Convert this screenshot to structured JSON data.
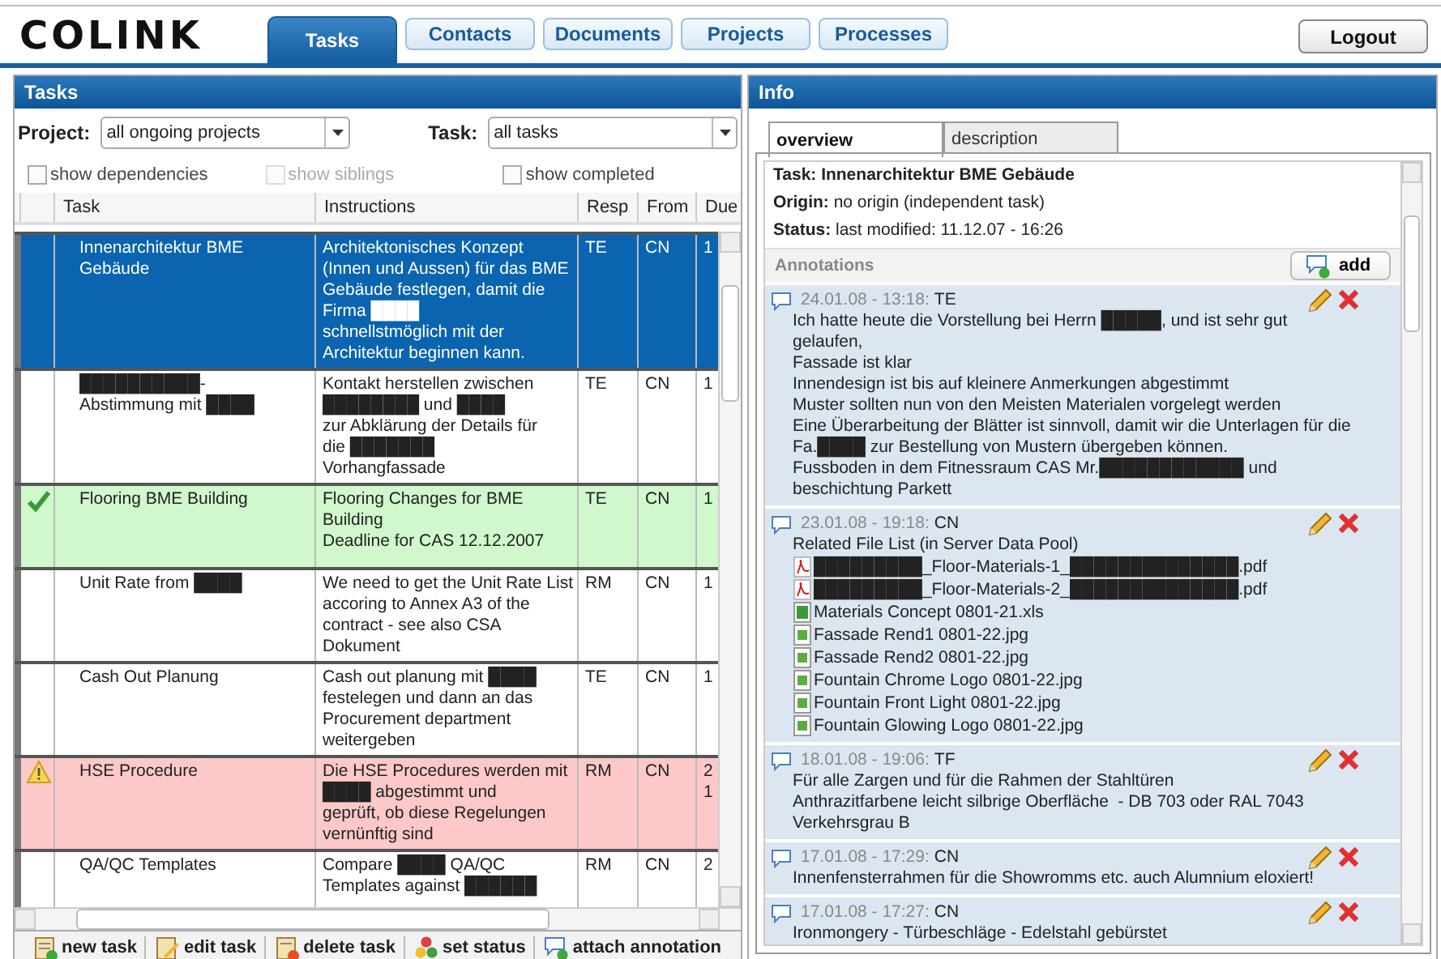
{
  "header": {
    "logo": "COLINK",
    "tabs": [
      {
        "label": "Tasks",
        "selected": true
      },
      {
        "label": "Contacts",
        "selected": false
      },
      {
        "label": "Documents",
        "selected": false
      },
      {
        "label": "Projects",
        "selected": false
      },
      {
        "label": "Processes",
        "selected": false
      }
    ],
    "logout": "Logout"
  },
  "tasks_panel": {
    "title": "Tasks",
    "filters": [
      {
        "label": "Project:",
        "value": "all ongoing projects"
      },
      {
        "label": "Task:",
        "value": "all tasks"
      }
    ],
    "options": [
      {
        "label": "show dependencies",
        "checked": false,
        "disabled": false
      },
      {
        "label": "show siblings",
        "checked": false,
        "disabled": true
      },
      {
        "label": "show completed",
        "checked": false,
        "disabled": false
      }
    ],
    "table": {
      "columns": [
        "Task",
        "Instructions",
        "Resp",
        "From",
        "Due"
      ],
      "rows": [
        {
          "selected": true,
          "kind": "plain",
          "task": "Innenarchitektur BME Gebäude",
          "instructions": "Architektonisches Konzept (Innen und Aussen) für das BME Gebäude festlegen, damit die Firma ████\nschnellstmöglich mit der Architektur beginnen kann.",
          "resp": "TE",
          "from": "CN",
          "due": "1"
        },
        {
          "selected": false,
          "kind": "plain",
          "task": "██████████-\nAbstimmung mit ████",
          "instructions": "Kontakt herstellen zwischen\n████████ und ████\nzur Abklärung der Details für\ndie ███████\nVorhangfassade",
          "resp": "TE",
          "from": "CN",
          "due": "1"
        },
        {
          "selected": false,
          "kind": "done",
          "task": "Flooring BME Building",
          "instructions": "Flooring Changes for BME Building\nDeadline for CAS 12.12.2007",
          "resp": "TE",
          "from": "CN",
          "due": "1"
        },
        {
          "selected": false,
          "kind": "plain",
          "task": "Unit Rate from ████",
          "instructions": "We need to get the Unit Rate List accoring to Annex A3 of the contract - see also CSA Dokument",
          "resp": "RM",
          "from": "CN",
          "due": "1"
        },
        {
          "selected": false,
          "kind": "plain",
          "task": "Cash Out Planung",
          "instructions": "Cash out planung mit ████\nfestelegen und dann an das Procurement department weitergeben",
          "resp": "TE",
          "from": "CN",
          "due": "1"
        },
        {
          "selected": false,
          "kind": "warning",
          "task": "HSE Procedure",
          "instructions": "Die HSE Procedures werden mit ████ abgestimmt und\ngeprüft, ob diese Regelungen vernünftig sind",
          "resp": "RM",
          "from": "CN",
          "due": "21"
        },
        {
          "selected": false,
          "kind": "plain",
          "task": "QA/QC Templates",
          "instructions": "Compare ████ QA/QC\nTemplates against ██████",
          "resp": "RM",
          "from": "CN",
          "due": "2"
        }
      ]
    },
    "toolbar": [
      {
        "kind": "new",
        "label": "new task"
      },
      {
        "kind": "edit",
        "label": "edit task"
      },
      {
        "kind": "delete",
        "label": "delete task"
      },
      {
        "kind": "status",
        "label": "set status"
      },
      {
        "kind": "annotate",
        "label": "attach annotation"
      }
    ]
  },
  "info_panel": {
    "title": "Info",
    "tabs": [
      {
        "label": "overview",
        "selected": true
      },
      {
        "label": "description",
        "selected": false
      }
    ],
    "task": "Task: Innenarchitektur BME Gebäude",
    "fields": [
      "**Origin:** no origin (independent task)",
      "**Status:** last modified: 11.12.07 - 16:26"
    ],
    "annotations_title": "Annotations",
    "add_button": "add",
    "annotations": [
      {
        "date": "24.01.08 - 13:18:",
        "author": "TE",
        "text": "Ich hatte heute die Vorstellung bei Herrn █████, und ist sehr gut gelaufen,\nFassade ist klar\nInnendesign ist bis auf kleinere Anmerkungen abgestimmt\nMuster sollten nun von den Meisten Materialen vorgelegt werden\nEine Überarbeitung der Blätter ist sinnvoll, damit wir die Unterlagen für die Fa.████ zur Bestellung von Mustern übergeben können.\nFussboden in dem Fitnessraum CAS Mr.████████████ und beschichtung Parkett"
      },
      {
        "date": "23.01.08 - 19:18:",
        "author": "CN",
        "text": "Related File List (in Server Data Pool)",
        "files": [
          {
            "kind": "pdf",
            "name": "█████████_Floor-Materials-1_██████████████.pdf"
          },
          {
            "kind": "pdf",
            "name": "█████████_Floor-Materials-2_██████████████.pdf"
          },
          {
            "kind": "xls",
            "name": "Materials Concept 0801-21.xls"
          },
          {
            "kind": "image",
            "name": "Fassade Rend1 0801-22.jpg"
          },
          {
            "kind": "image",
            "name": "Fassade Rend2 0801-22.jpg"
          },
          {
            "kind": "image",
            "name": "Fountain Chrome Logo 0801-22.jpg"
          },
          {
            "kind": "image",
            "name": "Fountain Front Light 0801-22.jpg"
          },
          {
            "kind": "image",
            "name": "Fountain Glowing Logo 0801-22.jpg"
          }
        ]
      },
      {
        "date": "18.01.08 - 19:06:",
        "author": "TF",
        "text": "Für alle Zargen und für die Rahmen der Stahltüren\nAnthrazitfarbene leicht silbrige Oberfläche  - DB 703 oder RAL 7043\nVerkehrsgrau B"
      },
      {
        "date": "17.01.08 - 17:29:",
        "author": "CN",
        "text": "Innenfensterrahmen für die Showromms etc. auch Alumnium eloxiert!"
      },
      {
        "date": "17.01.08 - 17:27:",
        "author": "CN",
        "text": "Ironmongery - Türbeschläge - Edelstahl gebürstet"
      }
    ]
  }
}
